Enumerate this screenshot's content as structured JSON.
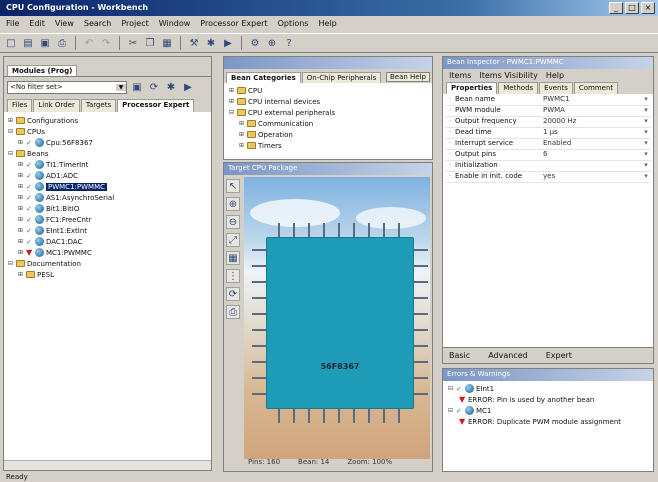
{
  "window": {
    "title": "CPU Configuration - Workbench",
    "min": "_",
    "max": "□",
    "close": "×"
  },
  "menus": [
    "File",
    "Edit",
    "View",
    "Search",
    "Project",
    "Window",
    "Processor Expert",
    "Options",
    "Help"
  ],
  "toolbar_icons": [
    "new-icon",
    "open-icon",
    "save-icon",
    "print-icon",
    "undo-icon",
    "redo-icon",
    "cut-icon",
    "copy-icon",
    "paste-icon",
    "build-icon",
    "debug-icon",
    "run-icon",
    "settings-icon",
    "zoom-icon",
    "help-icon"
  ],
  "project_panel": {
    "tab": "Modules (Prog)",
    "selector_value": "<No filter set>",
    "subtabs": [
      "Files",
      "Link Order",
      "Targets",
      "Processor Expert"
    ],
    "tree": [
      {
        "label": "Configurations",
        "type": "folder",
        "indent": 0,
        "twisty": "+"
      },
      {
        "label": "CPUs",
        "type": "folder",
        "indent": 0,
        "twisty": "-"
      },
      {
        "label": "Cpu:56F8367",
        "type": "cpu",
        "indent": 1,
        "twisty": "+"
      },
      {
        "label": "Beans",
        "type": "folder",
        "indent": 0,
        "twisty": "-"
      },
      {
        "label": "TI1:TimerInt",
        "type": "bean",
        "indent": 1,
        "twisty": "+"
      },
      {
        "label": "AD1:ADC",
        "type": "bean",
        "indent": 1,
        "twisty": "+"
      },
      {
        "label": "PWMC1:PWMMC",
        "type": "bean",
        "indent": 1,
        "twisty": "+",
        "selected": true
      },
      {
        "label": "AS1:AsynchroSerial",
        "type": "bean",
        "indent": 1,
        "twisty": "+"
      },
      {
        "label": "Bit1:BitIO",
        "type": "bean",
        "indent": 1,
        "twisty": "+"
      },
      {
        "label": "FC1:FreeCntr",
        "type": "bean",
        "indent": 1,
        "twisty": "+"
      },
      {
        "label": "EInt1:ExtInt",
        "type": "bean",
        "indent": 1,
        "twisty": "+"
      },
      {
        "label": "DAC1:DAC",
        "type": "bean",
        "indent": 1,
        "twisty": "+"
      },
      {
        "label": "MC1:PWMMC",
        "type": "bean-err",
        "indent": 1,
        "twisty": "+"
      },
      {
        "label": "Documentation",
        "type": "folder",
        "indent": 0,
        "twisty": "-"
      },
      {
        "label": "PESL",
        "type": "folder",
        "indent": 1,
        "twisty": "+"
      }
    ]
  },
  "bean_selector": {
    "tabs": [
      "Bean Categories",
      "On-Chip Peripherals"
    ],
    "button": "Bean Help",
    "tree": [
      {
        "label": "CPU",
        "indent": 0,
        "twisty": "+"
      },
      {
        "label": "CPU internal devices",
        "indent": 0,
        "twisty": "+"
      },
      {
        "label": "CPU external peripherals",
        "indent": 0,
        "twisty": "-"
      },
      {
        "label": "Communication",
        "indent": 1,
        "twisty": "+"
      },
      {
        "label": "Operation",
        "indent": 1,
        "twisty": "+"
      },
      {
        "label": "Timers",
        "indent": 1,
        "twisty": "+"
      }
    ]
  },
  "cpu_view": {
    "title": "Target CPU Package",
    "chip_label": "56F8367",
    "left_tools": [
      "pointer-icon",
      "zoom-in-icon",
      "zoom-out-icon",
      "fit-icon",
      "grid-icon",
      "pins-icon",
      "rotate-icon",
      "print-icon"
    ],
    "status": [
      "Pins: 160",
      "Bean: 14",
      "Zoom: 100%"
    ]
  },
  "inspector": {
    "title": "Bean Inspector - PWMC1:PWMMC",
    "menu": [
      "Items",
      "Items Visibility",
      "Help"
    ],
    "tabs": [
      "Properties",
      "Methods",
      "Events",
      "Comment"
    ],
    "rows": [
      {
        "name": "Bean name",
        "value": "PWMC1",
        "flag": ""
      },
      {
        "name": "PWM module",
        "value": "PWMA",
        "flag": ""
      },
      {
        "name": "Output frequency",
        "value": "20000 Hz",
        "flag": ""
      },
      {
        "name": "Dead time",
        "value": "1 µs",
        "flag": ""
      },
      {
        "name": "Interrupt service",
        "value": "Enabled",
        "flag": ""
      },
      {
        "name": "Output pins",
        "value": "6",
        "flag": ""
      },
      {
        "name": "Initialization",
        "value": "",
        "flag": ""
      },
      {
        "name": "Enable in init. code",
        "value": "yes",
        "flag": ""
      }
    ],
    "bottom_tabs": [
      "Basic",
      "Advanced",
      "Expert"
    ]
  },
  "errors": {
    "title": "Errors & Warnings",
    "rows": [
      {
        "label": "EInt1",
        "type": "warn",
        "indent": 0
      },
      {
        "label": "ERROR: Pin is used by another bean",
        "type": "err",
        "indent": 1
      },
      {
        "label": "MC1",
        "type": "warn",
        "indent": 0
      },
      {
        "label": "ERROR: Duplicate PWM module assignment",
        "type": "err",
        "indent": 1
      }
    ]
  },
  "status_bar": {
    "left": "Ready",
    "right": ""
  }
}
